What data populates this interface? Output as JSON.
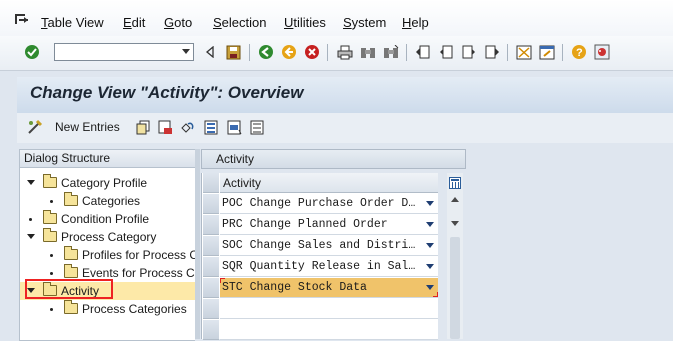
{
  "menu": {
    "items": [
      {
        "key": "T",
        "rest": "able View"
      },
      {
        "key": "E",
        "rest": "dit"
      },
      {
        "key": "G",
        "rest": "oto"
      },
      {
        "key": "S",
        "rest": "election"
      },
      {
        "key": "U",
        "rest": "tilities"
      },
      {
        "key": "S",
        "rest": "ystem"
      },
      {
        "key": "H",
        "rest": "elp"
      }
    ]
  },
  "toolbar": {
    "command_field_value": ""
  },
  "title": "Change View \"Activity\": Overview",
  "app_toolbar": {
    "new_entries_label": "New Entries"
  },
  "tree": {
    "header": "Dialog Structure",
    "nodes": [
      {
        "label": "Category Profile"
      },
      {
        "label": "Categories"
      },
      {
        "label": "Condition Profile"
      },
      {
        "label": "Process Category"
      },
      {
        "label": "Profiles for Process C"
      },
      {
        "label": "Events for Process C"
      },
      {
        "label": "Activity"
      },
      {
        "label": "Process Categories"
      }
    ]
  },
  "table": {
    "panel_title": "Activity",
    "column_header": "Activity",
    "rows": [
      {
        "code": "POC",
        "text": "POC Change Purchase Order D…"
      },
      {
        "code": "PRC",
        "text": "PRC Change Planned Order"
      },
      {
        "code": "SOC",
        "text": "SOC Change Sales and Distri…"
      },
      {
        "code": "SQR",
        "text": "SQR Quantity Release in Sal…"
      },
      {
        "code": "STC",
        "text": "STC Change Stock Data"
      }
    ],
    "selected_row_index": 4
  },
  "colors": {
    "selected_row": "#f0c36a",
    "tree_selected": "#fde9a8",
    "highlight_box": "#e22222"
  }
}
